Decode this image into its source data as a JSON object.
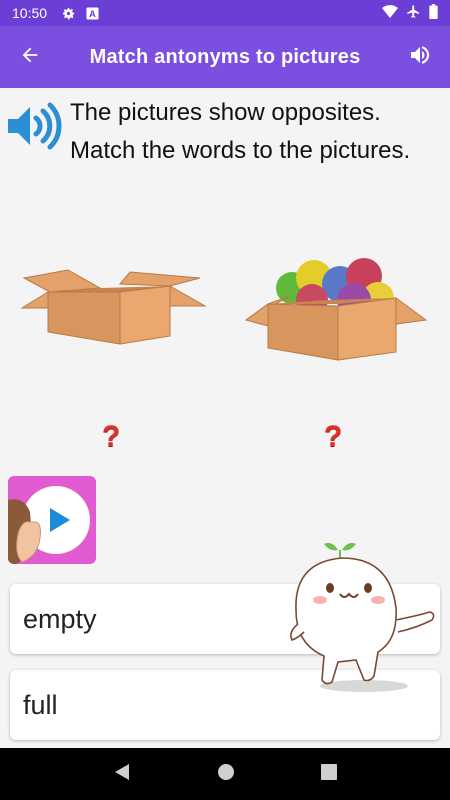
{
  "status_bar": {
    "time": "10:50",
    "icons_left": [
      "gear-icon",
      "a-badge-icon"
    ],
    "icons_right": [
      "wifi-icon",
      "airplane-icon",
      "battery-icon"
    ]
  },
  "app_bar": {
    "title": "Match antonyms to pictures",
    "back_icon": "arrow-left-icon",
    "sound_icon": "volume-icon"
  },
  "instruction": {
    "line1": "The pictures show opposites.",
    "line2": "Match the words to the pictures."
  },
  "pictures": [
    {
      "name": "empty-box",
      "placeholder": "?"
    },
    {
      "name": "full-box",
      "placeholder": "?"
    }
  ],
  "answers": [
    {
      "label": "empty"
    },
    {
      "label": "full"
    }
  ],
  "colors": {
    "status_bar": "#6b3fd6",
    "app_bar": "#7b4fe0",
    "question_mark": "#e0302a",
    "video_button": "#e15bd0",
    "box": "#e9a46a"
  }
}
